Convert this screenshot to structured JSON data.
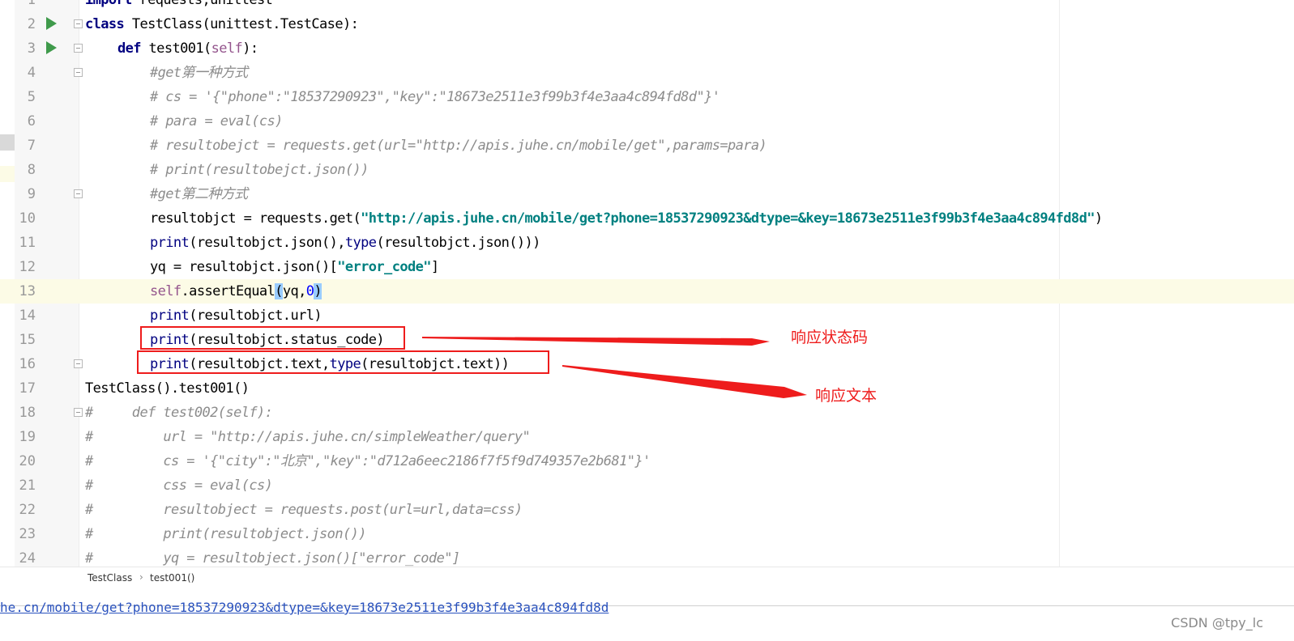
{
  "editor": {
    "lines": [
      {
        "n": "1",
        "indent": 105,
        "run": false,
        "fold": false,
        "current": false,
        "segs": [
          {
            "c": "kw",
            "t": "import "
          },
          {
            "c": "",
            "t": "requests,unittest"
          }
        ]
      },
      {
        "n": "2",
        "indent": 105,
        "run": true,
        "fold": true,
        "current": false,
        "segs": [
          {
            "c": "kw",
            "t": "class "
          },
          {
            "c": "",
            "t": "TestClass(unittest.TestCase):"
          }
        ]
      },
      {
        "n": "3",
        "indent": 145,
        "run": true,
        "fold": true,
        "current": false,
        "segs": [
          {
            "c": "kw",
            "t": "def "
          },
          {
            "c": "",
            "t": "test001("
          },
          {
            "c": "self",
            "t": "self"
          },
          {
            "c": "",
            "t": "):"
          }
        ]
      },
      {
        "n": "4",
        "indent": 185,
        "run": false,
        "fold": true,
        "current": false,
        "segs": [
          {
            "c": "cmt",
            "t": "#get第一种方式"
          }
        ]
      },
      {
        "n": "5",
        "indent": 185,
        "run": false,
        "fold": false,
        "current": false,
        "segs": [
          {
            "c": "cmt",
            "t": "# cs = '{\"phone\":\"18537290923\",\"key\":\"18673e2511e3f99b3f4e3aa4c894fd8d\"}'"
          }
        ]
      },
      {
        "n": "6",
        "indent": 185,
        "run": false,
        "fold": false,
        "current": false,
        "segs": [
          {
            "c": "cmt",
            "t": "# para = eval(cs)"
          }
        ]
      },
      {
        "n": "7",
        "indent": 185,
        "run": false,
        "fold": false,
        "current": false,
        "segs": [
          {
            "c": "cmt",
            "t": "# resultobejct = requests.get(url=\"http://apis.juhe.cn/mobile/get\",params=para)"
          }
        ]
      },
      {
        "n": "8",
        "indent": 185,
        "run": false,
        "fold": false,
        "current": false,
        "segs": [
          {
            "c": "cmt",
            "t": "# print(resultobejct.json())"
          }
        ]
      },
      {
        "n": "9",
        "indent": 185,
        "run": false,
        "fold": true,
        "current": false,
        "segs": [
          {
            "c": "cmt",
            "t": "#get第二种方式"
          }
        ]
      },
      {
        "n": "10",
        "indent": 185,
        "run": false,
        "fold": false,
        "current": false,
        "segs": [
          {
            "c": "",
            "t": "resultobjct = requests.get("
          },
          {
            "c": "str",
            "t": "\"http://apis.juhe.cn/mobile/get?phone=18537290923&dtype=&key=18673e2511e3f99b3f4e3aa4c894fd8d\""
          },
          {
            "c": "",
            "t": ")"
          }
        ]
      },
      {
        "n": "11",
        "indent": 185,
        "run": false,
        "fold": false,
        "current": false,
        "segs": [
          {
            "c": "bi",
            "t": "print"
          },
          {
            "c": "",
            "t": "(resultobjct.json(),"
          },
          {
            "c": "bi",
            "t": "type"
          },
          {
            "c": "",
            "t": "(resultobjct.json()))"
          }
        ]
      },
      {
        "n": "12",
        "indent": 185,
        "run": false,
        "fold": false,
        "current": false,
        "segs": [
          {
            "c": "",
            "t": "yq = resultobjct.json()["
          },
          {
            "c": "str",
            "t": "\"error_code\""
          },
          {
            "c": "",
            "t": "]"
          }
        ]
      },
      {
        "n": "13",
        "indent": 185,
        "run": false,
        "fold": false,
        "current": true,
        "segs": [
          {
            "c": "self",
            "t": "self"
          },
          {
            "c": "",
            "t": ".assertEqual"
          },
          {
            "c": "brace-hl",
            "t": "("
          },
          {
            "c": "",
            "t": "yq,"
          },
          {
            "c": "num",
            "t": "0"
          },
          {
            "c": "brace-hl",
            "t": ")"
          }
        ]
      },
      {
        "n": "14",
        "indent": 185,
        "run": false,
        "fold": false,
        "current": false,
        "segs": [
          {
            "c": "bi",
            "t": "print"
          },
          {
            "c": "",
            "t": "(resultobjct.url)"
          }
        ]
      },
      {
        "n": "15",
        "indent": 185,
        "run": false,
        "fold": false,
        "current": false,
        "segs": [
          {
            "c": "bi",
            "t": "print"
          },
          {
            "c": "",
            "t": "(resultobjct.status_code)"
          }
        ]
      },
      {
        "n": "16",
        "indent": 185,
        "run": false,
        "fold": true,
        "current": false,
        "segs": [
          {
            "c": "bi",
            "t": "print"
          },
          {
            "c": "",
            "t": "(resultobjct.text,"
          },
          {
            "c": "bi",
            "t": "type"
          },
          {
            "c": "",
            "t": "(resultobjct.text))"
          }
        ]
      },
      {
        "n": "17",
        "indent": 105,
        "run": false,
        "fold": false,
        "current": false,
        "segs": [
          {
            "c": "",
            "t": "TestClass().test001()"
          }
        ]
      },
      {
        "n": "18",
        "indent": 105,
        "run": false,
        "fold": true,
        "current": false,
        "segs": [
          {
            "c": "cmt",
            "t": "#     def test002(self):"
          }
        ]
      },
      {
        "n": "19",
        "indent": 105,
        "run": false,
        "fold": false,
        "current": false,
        "segs": [
          {
            "c": "cmt",
            "t": "#         url = \"http://apis.juhe.cn/simpleWeather/query\""
          }
        ]
      },
      {
        "n": "20",
        "indent": 105,
        "run": false,
        "fold": false,
        "current": false,
        "segs": [
          {
            "c": "cmt",
            "t": "#         cs = '{\"city\":\"北京\",\"key\":\"d712a6eec2186f7f5f9d749357e2b681\"}'"
          }
        ]
      },
      {
        "n": "21",
        "indent": 105,
        "run": false,
        "fold": false,
        "current": false,
        "segs": [
          {
            "c": "cmt",
            "t": "#         css = eval(cs)"
          }
        ]
      },
      {
        "n": "22",
        "indent": 105,
        "run": false,
        "fold": false,
        "current": false,
        "segs": [
          {
            "c": "cmt",
            "t": "#         resultobject = requests.post(url=url,data=css)"
          }
        ]
      },
      {
        "n": "23",
        "indent": 105,
        "run": false,
        "fold": false,
        "current": false,
        "segs": [
          {
            "c": "cmt",
            "t": "#         print(resultobject.json())"
          }
        ]
      },
      {
        "n": "24",
        "indent": 105,
        "run": false,
        "fold": false,
        "current": false,
        "segs": [
          {
            "c": "cmt",
            "t": "#         yq = resultobject.json()[\"error_code\"]"
          }
        ]
      }
    ]
  },
  "annotations": {
    "status_label": "响应状态码",
    "text_label": "响应文本",
    "color": "#ee1c1c"
  },
  "breadcrumb": {
    "items": [
      "TestClass",
      "test001()"
    ]
  },
  "console": {
    "output_line": "he.cn/mobile/get?phone=18537290923&dtype=&key=18673e2511e3f99b3f4e3aa4c894fd8d"
  },
  "watermark": "CSDN @tpy_lc"
}
